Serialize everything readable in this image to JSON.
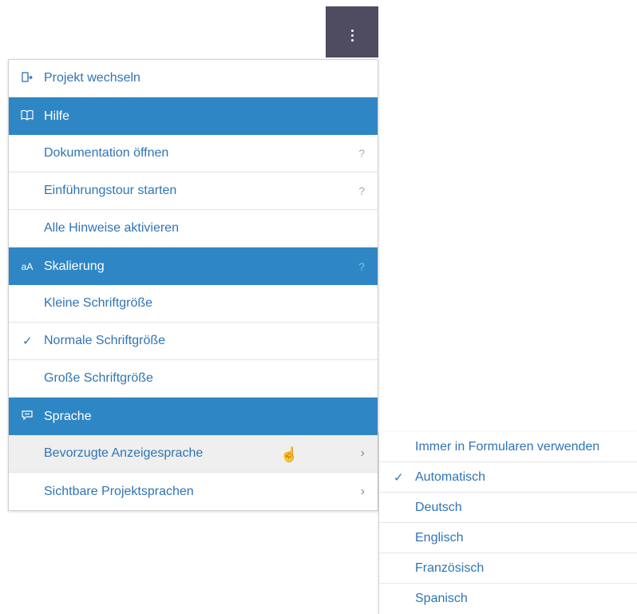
{
  "kebab_button": {
    "icon": "more-vertical-icon"
  },
  "menu": {
    "items": [
      {
        "label": "Projekt wechseln",
        "icon": "switch-project-icon"
      },
      {
        "label": "Hilfe",
        "icon": "book-icon"
      },
      {
        "label": "Dokumentation öffnen",
        "hint": "?"
      },
      {
        "label": "Einführungstour starten",
        "hint": "?"
      },
      {
        "label": "Alle Hinweise aktivieren"
      },
      {
        "label": "Skalierung",
        "icon_text": "aA",
        "hint": "?"
      },
      {
        "label": "Kleine Schriftgröße"
      },
      {
        "label": "Normale Schriftgröße",
        "checked": true
      },
      {
        "label": "Große Schriftgröße"
      },
      {
        "label": "Sprache",
        "icon": "speech-bubble-icon"
      },
      {
        "label": "Bevorzugte Anzeigesprache",
        "chevron": "›"
      },
      {
        "label": "Sichtbare Projektsprachen",
        "chevron": "›"
      }
    ]
  },
  "submenu": {
    "items": [
      {
        "label": "Immer in Formularen verwenden"
      },
      {
        "label": "Automatisch",
        "checked": true
      },
      {
        "label": "Deutsch"
      },
      {
        "label": "Englisch"
      },
      {
        "label": "Französisch"
      },
      {
        "label": "Spanisch"
      }
    ]
  },
  "colors": {
    "accent": "#2f86c4",
    "link": "#2f74b5",
    "kebab_bg": "#4f4b60",
    "hover_bg": "#efefef"
  }
}
